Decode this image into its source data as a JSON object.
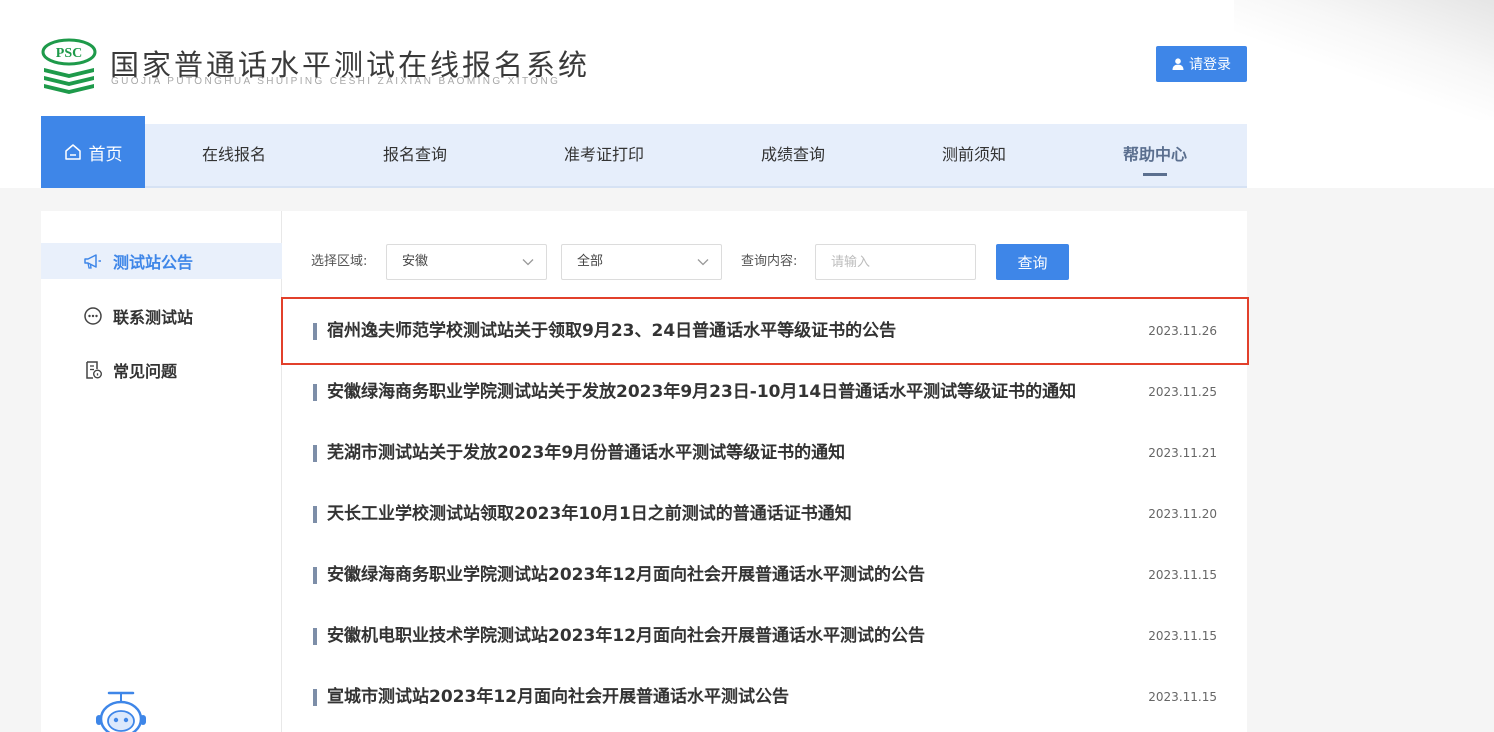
{
  "header": {
    "logo_badge": "PSC",
    "title": "国家普通话水平测试在线报名系统",
    "subtitle": "GUOJIA PUTONGHUA SHUIPING CESHI ZAIXIAN BAOMING XITONG",
    "login_label": "请登录"
  },
  "nav": {
    "items": [
      {
        "label": "首页"
      },
      {
        "label": "在线报名"
      },
      {
        "label": "报名查询"
      },
      {
        "label": "准考证打印"
      },
      {
        "label": "成绩查询"
      },
      {
        "label": "测前须知"
      },
      {
        "label": "帮助中心"
      }
    ],
    "active": "帮助中心",
    "highlighted": "首页"
  },
  "sidebar": {
    "items": [
      {
        "label": "测试站公告",
        "icon": "megaphone-icon",
        "active": true
      },
      {
        "label": "联系测试站",
        "icon": "chat-bubble-icon",
        "active": false
      },
      {
        "label": "常见问题",
        "icon": "document-question-icon",
        "active": false
      }
    ]
  },
  "filters": {
    "region_label": "选择区域:",
    "region_value": "安徽",
    "station_value": "全部",
    "query_label": "查询内容:",
    "query_placeholder": "请输入",
    "query_value": "",
    "query_button": "查询"
  },
  "announcements": [
    {
      "title": "宿州逸夫师范学校测试站关于领取9月23、24日普通话水平等级证书的公告",
      "date": "2023.11.26",
      "highlighted": true
    },
    {
      "title": "安徽绿海商务职业学院测试站关于发放2023年9月23日-10月14日普通话水平测试等级证书的通知",
      "date": "2023.11.25"
    },
    {
      "title": "芜湖市测试站关于发放2023年9月份普通话水平测试等级证书的通知",
      "date": "2023.11.21"
    },
    {
      "title": "天长工业学校测试站领取2023年10月1日之前测试的普通话证书通知",
      "date": "2023.11.20"
    },
    {
      "title": "安徽绿海商务职业学院测试站2023年12月面向社会开展普通话水平测试的公告",
      "date": "2023.11.15"
    },
    {
      "title": "安徽机电职业技术学院测试站2023年12月面向社会开展普通话水平测试的公告",
      "date": "2023.11.15"
    },
    {
      "title": "宣城市测试站2023年12月面向社会开展普通话水平测试公告",
      "date": "2023.11.15"
    }
  ],
  "colors": {
    "primary": "#3e86e8",
    "nav_bg": "#e6eefb",
    "active_nav": "#5b6f8f",
    "highlight_border": "#e2402b"
  }
}
